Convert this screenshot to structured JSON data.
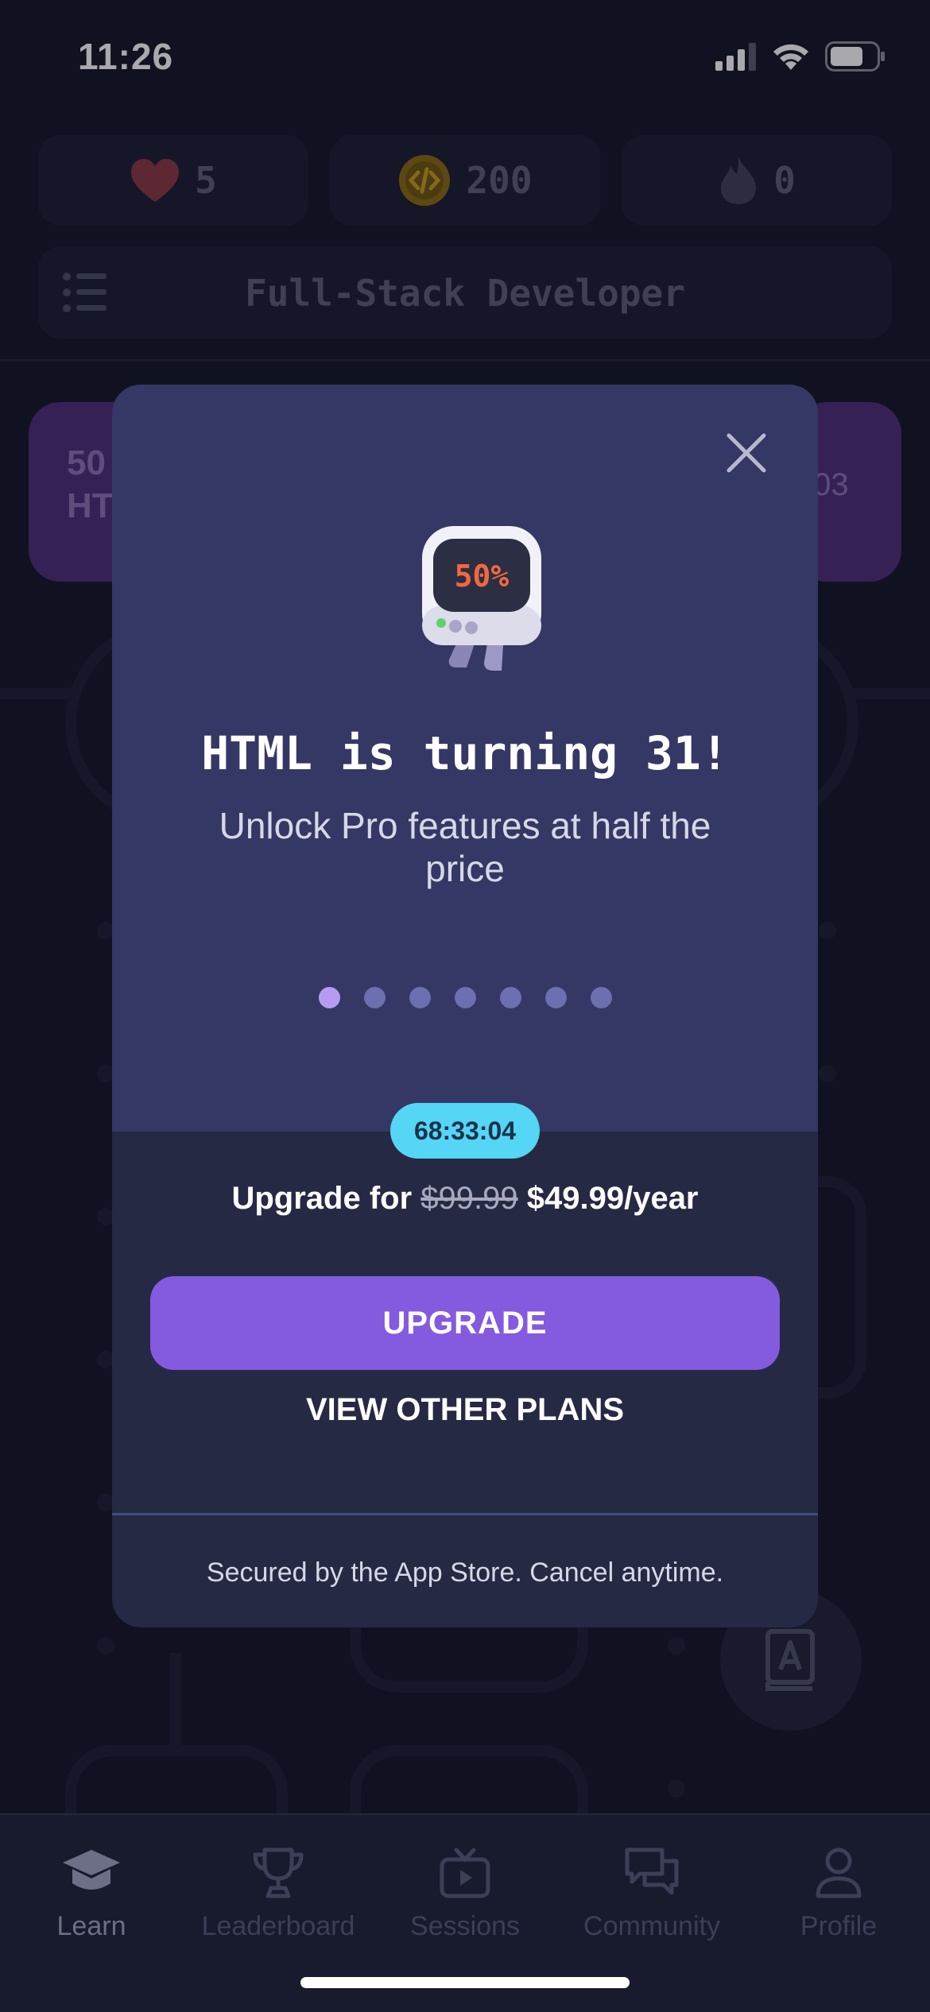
{
  "status_bar": {
    "time": "11:26"
  },
  "stats": {
    "hearts": "5",
    "coins": "200",
    "streak": "0"
  },
  "course": {
    "title": "Full-Stack Developer"
  },
  "background": {
    "left_card_line1": "50",
    "left_card_line2": "HT",
    "right_card_text": ":03"
  },
  "modal": {
    "title": "HTML is turning 31!",
    "subtitle": "Unlock Pro features at half the price",
    "mascot_label": "50%",
    "dots_count": 7,
    "active_dot": 1,
    "timer": "68:33:04",
    "price_prefix": "Upgrade for ",
    "price_old": "$99.99",
    "price_new": " $49.99/year",
    "upgrade_label": "UPGRADE",
    "other_plans_label": "VIEW OTHER PLANS",
    "footer": "Secured by the App Store. Cancel anytime."
  },
  "tabs": [
    {
      "label": "Learn",
      "icon": "graduation-cap-icon",
      "active": true
    },
    {
      "label": "Leaderboard",
      "icon": "trophy-icon",
      "active": false
    },
    {
      "label": "Sessions",
      "icon": "tv-play-icon",
      "active": false
    },
    {
      "label": "Community",
      "icon": "chat-bubbles-icon",
      "active": false
    },
    {
      "label": "Profile",
      "icon": "person-icon",
      "active": false
    }
  ],
  "colors": {
    "accent": "#845adf",
    "timer": "#55d6f5",
    "modal_top": "#353865",
    "modal_bottom": "#262944"
  }
}
